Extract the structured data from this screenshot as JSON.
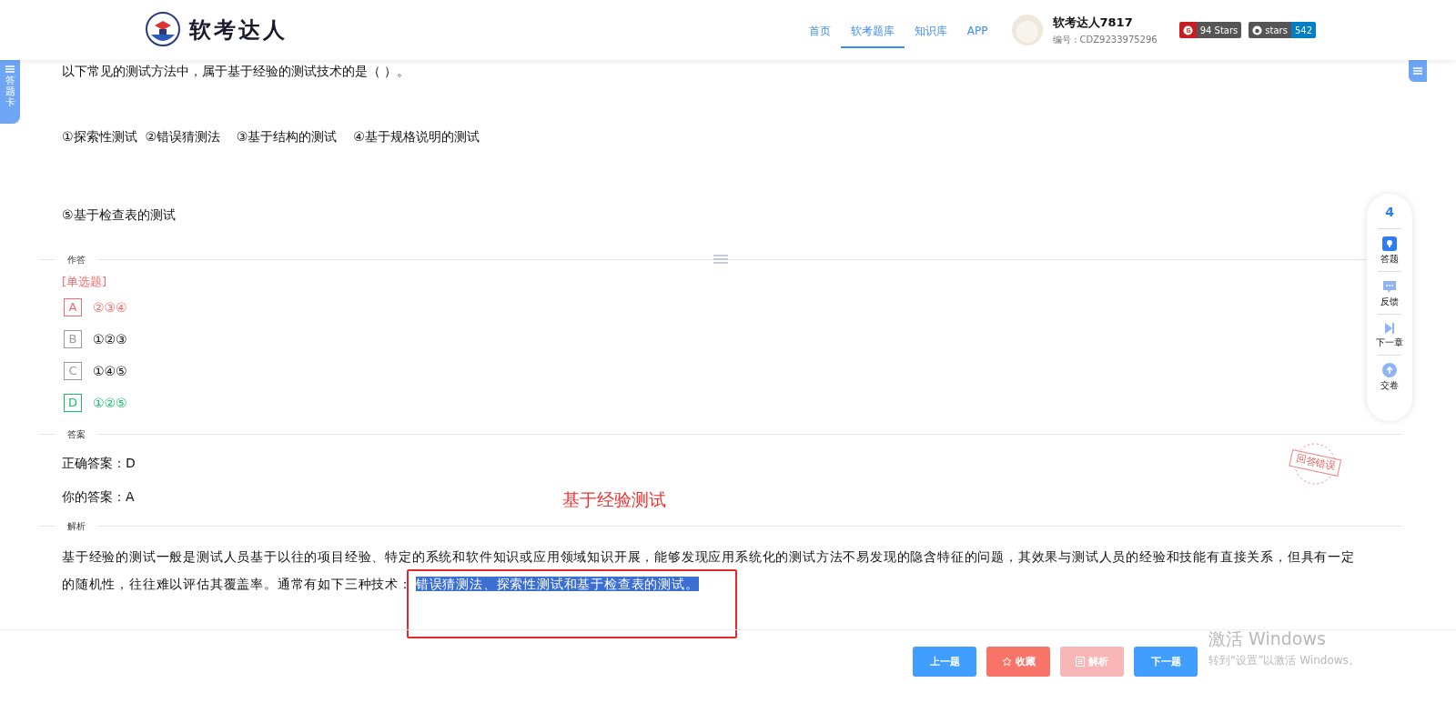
{
  "header": {
    "logo_text": "软考达人",
    "nav": [
      {
        "label": "首页",
        "selected": false
      },
      {
        "label": "软考题库",
        "selected": true
      },
      {
        "label": "知识库",
        "selected": false
      },
      {
        "label": "APP",
        "selected": false
      }
    ],
    "user": {
      "name": "软考达人7817",
      "id": "编号：CDZ9233975296"
    },
    "badges": [
      {
        "kind": "gitee",
        "label": "94 Stars"
      },
      {
        "kind": "github",
        "label": "stars",
        "count": "542"
      }
    ]
  },
  "left_tab": "答题卡",
  "question": {
    "stem": "以下常见的测试方法中，属于基于经验的测试技术的是（ ）。",
    "lines": [
      "①探索性测试  ②错误猜测法    ③基于结构的测试    ④基于规格说明的测试",
      "⑤基于检查表的测试"
    ]
  },
  "answer_section": {
    "title": "作答",
    "type": "[单选题]",
    "options": [
      {
        "letter": "A",
        "text": "②③④",
        "chosen": true,
        "correct": false
      },
      {
        "letter": "B",
        "text": "①②③",
        "chosen": false,
        "correct": false
      },
      {
        "letter": "C",
        "text": "①④⑤",
        "chosen": false,
        "correct": false
      },
      {
        "letter": "D",
        "text": "①②⑤",
        "chosen": false,
        "correct": true
      }
    ]
  },
  "key_section": {
    "title": "答案",
    "correct": "正确答案：D",
    "yours": "你的答案：A",
    "stamp": "回答错误"
  },
  "analysis_section": {
    "title": "解析",
    "text": "基于经验的测试一般是测试人员基于以往的项目经验、特定的系统和软件知识或应用领域知识开展，能够发现应用系统化的测试方法不易发现的隐含特征的问题，其效果与测试人员的经验和技能有直接关系，但具有一定的随机性，往往难以评估其覆盖率。通常有如下三种技术：",
    "selected_text": "错误猜测法、探索性测试和基于检查表的测试。"
  },
  "annotation": "基于经验测试",
  "side_panel": {
    "count": "4",
    "items": [
      {
        "kind": "answer",
        "label": "答题"
      },
      {
        "kind": "feedback",
        "label": "反馈"
      },
      {
        "kind": "next",
        "label": "下一章"
      },
      {
        "kind": "submit",
        "label": "交卷"
      }
    ]
  },
  "footer_buttons": [
    {
      "kind": "primary",
      "label": "上一题",
      "disabled": false
    },
    {
      "kind": "star",
      "label": "收藏",
      "disabled": false
    },
    {
      "kind": "doc",
      "label": "解析",
      "disabled": true
    },
    {
      "kind": "primary",
      "label": "下一题",
      "disabled": false
    }
  ],
  "os_notice": {
    "title": "激活 Windows",
    "text": "转到“设置”以激活 Windows。"
  }
}
